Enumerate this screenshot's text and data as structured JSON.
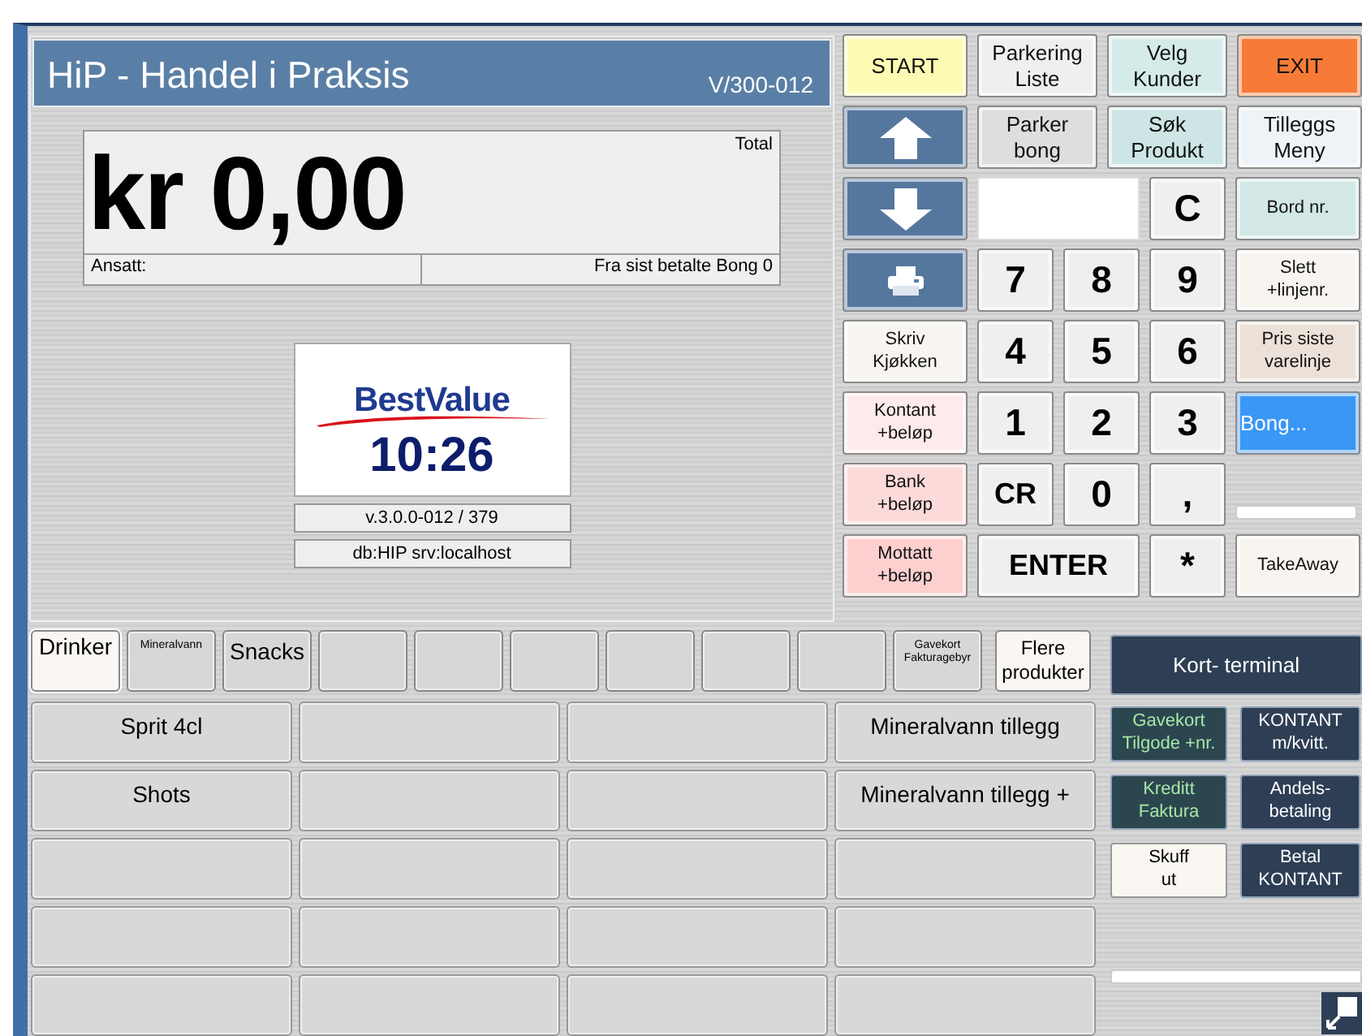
{
  "header": {
    "title": "HiP - Handel i Praksis",
    "version": "V/300-012"
  },
  "display": {
    "amount": "kr 0,00",
    "total_label": "Total",
    "employee_label": "Ansatt:",
    "last_receipt": "Fra sist betalte Bong 0"
  },
  "logo": {
    "brand": "BestValue",
    "clock": "10:26"
  },
  "info": [
    "v.3.0.0-012 / 379",
    "db:HIP srv:localhost"
  ],
  "keypad_rows": [
    {
      "keys": [
        {
          "kind": "label",
          "label": "START",
          "color": "#fdfbb3"
        },
        {
          "kind": "label",
          "label": "Parkering\nListe",
          "color": "#efefef"
        },
        {
          "kind": "label",
          "label": "Velg\nKunder",
          "color": "#d5ebea"
        },
        {
          "kind": "label",
          "label": "EXIT",
          "color": "#f77b37"
        }
      ]
    },
    {
      "keys": [
        {
          "kind": "arrow-up"
        },
        {
          "kind": "label",
          "label": "Parker\nbong",
          "color": "#dedede"
        },
        {
          "kind": "label",
          "label": "Søk\nProdukt",
          "color": "#cde5e4"
        },
        {
          "kind": "label",
          "label": "Tilleggs\nMeny",
          "color": "#eef3f7"
        }
      ]
    },
    {
      "keys": [
        {
          "kind": "arrow-down"
        },
        {
          "kind": "field"
        },
        {
          "kind": "digit",
          "label": "C"
        },
        {
          "kind": "note",
          "label": "Bord nr.",
          "color": "#d3e7e6"
        }
      ]
    },
    {
      "keys": [
        {
          "kind": "print"
        },
        {
          "kind": "digit",
          "label": "7"
        },
        {
          "kind": "digit",
          "label": "8"
        },
        {
          "kind": "digit",
          "label": "9"
        },
        {
          "kind": "note",
          "label": "Slett\n+linjenr.",
          "color": "#f8f4f0"
        }
      ]
    },
    {
      "keys": [
        {
          "kind": "note",
          "label": "Skriv\nKjøkken",
          "color": "#f8f4f0"
        },
        {
          "kind": "digit",
          "label": "4"
        },
        {
          "kind": "digit",
          "label": "5"
        },
        {
          "kind": "digit",
          "label": "6"
        },
        {
          "kind": "note",
          "label": "Pris siste\nvarelinje",
          "color": "#ece1d8"
        }
      ]
    },
    {
      "keys": [
        {
          "kind": "note",
          "label": "Kontant\n+beløp",
          "color": "#fdeaea"
        },
        {
          "kind": "digit",
          "label": "1"
        },
        {
          "kind": "digit",
          "label": "2"
        },
        {
          "kind": "digit",
          "label": "3"
        },
        {
          "kind": "highlight",
          "label": "Bong...",
          "color": "#3a97f5"
        }
      ]
    },
    {
      "keys": [
        {
          "kind": "note",
          "label": "Bank\n+beløp",
          "color": "#fddada"
        },
        {
          "kind": "digit",
          "label": "CR"
        },
        {
          "kind": "digit",
          "label": "0"
        },
        {
          "kind": "digit",
          "label": ","
        },
        {
          "kind": "bar"
        }
      ]
    },
    {
      "keys": [
        {
          "kind": "note",
          "label": "Mottatt\n+beløp",
          "color": "#fdcfcf"
        },
        {
          "kind": "enter",
          "label": "ENTER"
        },
        {
          "kind": "digit",
          "label": "*"
        },
        {
          "kind": "note",
          "label": "TakeAway",
          "color": "#f8f4f0"
        }
      ]
    }
  ],
  "category_tabs": [
    {
      "label": "Drinker",
      "selected": true
    },
    {
      "label": "Mineralvann",
      "selected": false,
      "kind": "tiny"
    },
    {
      "label": "Snacks",
      "selected": false
    },
    {
      "selected": false
    },
    {
      "selected": false
    },
    {
      "selected": false
    },
    {
      "selected": false
    },
    {
      "selected": false
    },
    {
      "selected": false
    },
    {
      "label": "Gavekort\nFakturagebyr",
      "selected": false,
      "kind": "tiny"
    }
  ],
  "more_products": "Flere\nprodukter",
  "products": [
    {
      "kind": "item",
      "label": "Sprit 4cl"
    },
    {
      "kind": "blank"
    },
    {
      "kind": "blank"
    },
    {
      "kind": "item",
      "label": "Mineralvann tillegg"
    },
    {
      "kind": "item",
      "label": "Shots"
    },
    {
      "kind": "blank"
    },
    {
      "kind": "blank"
    },
    {
      "kind": "item",
      "label": "Mineralvann tillegg +"
    },
    {
      "kind": "blank"
    },
    {
      "kind": "blank"
    },
    {
      "kind": "blank"
    },
    {
      "kind": "blank"
    },
    {
      "kind": "blank"
    },
    {
      "kind": "blank"
    },
    {
      "kind": "blank"
    },
    {
      "kind": "blank"
    },
    {
      "kind": "blank"
    },
    {
      "kind": "blank"
    },
    {
      "kind": "blank"
    },
    {
      "kind": "blank"
    }
  ],
  "terminal": "Kort- terminal",
  "payments": [
    {
      "label": "Gavekort\nTilgode +nr.",
      "kind": "credit"
    },
    {
      "label": "KONTANT\nm/kvitt.",
      "kind": "cash"
    },
    {
      "label": "Kreditt\nFaktura",
      "kind": "credit"
    },
    {
      "label": "Andels-\nbetaling",
      "kind": "cash"
    },
    {
      "label": "Skuff\nut",
      "kind": "drawer"
    },
    {
      "label": "Betal\nKONTANT",
      "kind": "cash"
    }
  ]
}
